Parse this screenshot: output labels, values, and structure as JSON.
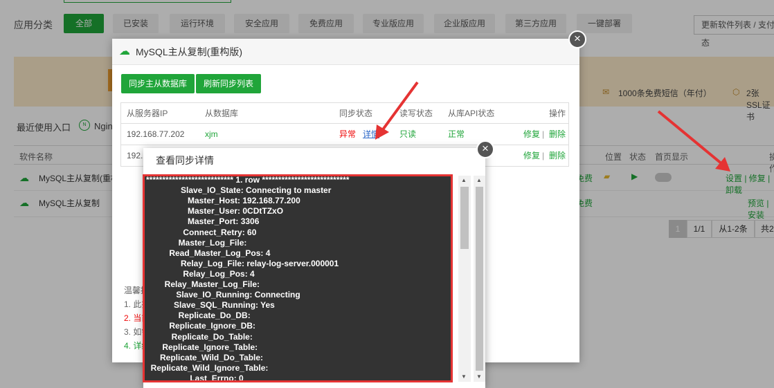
{
  "category": {
    "label": "应用分类",
    "buttons": [
      "全部",
      "已安装",
      "运行环境",
      "安全应用",
      "免费应用",
      "专业版应用",
      "企业版应用",
      "第三方应用",
      "一键部署"
    ],
    "update_button": "更新软件列表 / 支付状态"
  },
  "banner": {
    "sms": "1000条免费短信（年付）",
    "ssl": "2张SSL证书"
  },
  "recent_label": "最近使用入口",
  "recent_item": "Nginx",
  "table_head": {
    "name": "软件名称",
    "position": "位置",
    "status": "状态",
    "home": "首页显示",
    "ops": "操作"
  },
  "rows": [
    {
      "name": "MySQL主从复制(重构版)",
      "price": "免费",
      "ops": "设置 | 修复 | 卸载"
    },
    {
      "name": "MySQL主从复制",
      "price": "免费",
      "ops": "预览 | 安装"
    }
  ],
  "pager": {
    "current": "1",
    "total": "1/1",
    "range": "从1-2条",
    "count": "共2条"
  },
  "tips": {
    "title": "温馨提示",
    "l1": "1. 此插件…",
    "l2": "2. 当前…",
    "l3": "3. 如需…",
    "l4": "4. 详细…"
  },
  "main_modal": {
    "title": "MySQL主从复制(重构版)",
    "sync_button": "同步主从数据库",
    "refresh_button": "刷新同步列表",
    "columns": [
      "从服务器IP",
      "从数据库",
      "同步状态",
      "读写状态",
      "从库API状态",
      "操作"
    ],
    "rows": [
      {
        "ip": "192.168.77.202",
        "db": "xjm",
        "sync": "异常",
        "detail": "详情",
        "rw": "只读",
        "api": "正常",
        "fix": "修复",
        "del": "删除"
      },
      {
        "ip": "192.",
        "fix": "修复",
        "del": "删除"
      }
    ]
  },
  "detail_modal": {
    "title": "查看同步详情",
    "lines": [
      "*************************** 1. row ***************************",
      "               Slave_IO_State: Connecting to master",
      "                  Master_Host: 192.168.77.200",
      "                  Master_User: 0CDtTZxO",
      "                  Master_Port: 3306",
      "                Connect_Retry: 60",
      "              Master_Log_File:",
      "          Read_Master_Log_Pos: 4",
      "               Relay_Log_File: relay-log-server.000001",
      "                Relay_Log_Pos: 4",
      "        Relay_Master_Log_File:",
      "             Slave_IO_Running: Connecting",
      "            Slave_SQL_Running: Yes",
      "              Replicate_Do_DB:",
      "          Replicate_Ignore_DB:",
      "           Replicate_Do_Table:",
      "       Replicate_Ignore_Table:",
      "      Replicate_Wild_Do_Table:",
      "  Replicate_Wild_Ignore_Table:",
      "                   Last_Errno: 0"
    ]
  },
  "colors": {
    "green": "#20a53a",
    "red": "#e53333",
    "terminal": "#333333"
  }
}
